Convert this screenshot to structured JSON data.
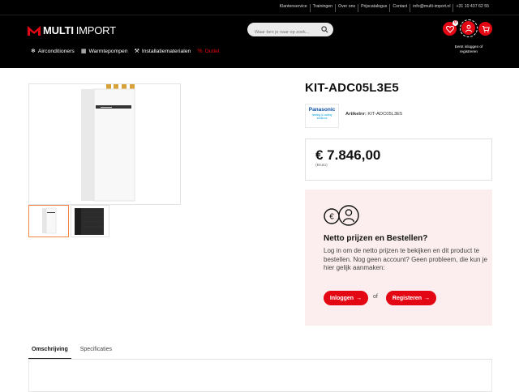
{
  "topbar": {
    "links": [
      "Klantenservice",
      "Trainingen",
      "Over ons",
      "Prijscatalogus",
      "Contact",
      "info@multi-import.nl",
      "+31 10 437 62 55"
    ]
  },
  "logo": {
    "multi": "MULTI",
    "import": "IMPORT",
    "brand_color": "#e30613"
  },
  "search": {
    "placeholder": "Waar ben je naar op zoek..."
  },
  "header_icons": {
    "wishlist_count": "0",
    "login_text": "Eerst inloggen of registreren"
  },
  "nav": {
    "items": [
      {
        "label": "Airconditioners",
        "icon": "snowflake-icon"
      },
      {
        "label": "Warmtepompen",
        "icon": "heatpump-icon"
      },
      {
        "label": "Installatiematerialen",
        "icon": "tools-icon"
      },
      {
        "label": "Outlet",
        "icon": "percent-icon"
      }
    ]
  },
  "product": {
    "title": "KIT-ADC05L3E5",
    "brand": "Panasonic",
    "brand_tagline": "heating & cooling solutions",
    "article_label": "Artikelnr:",
    "article_number": "KIT-ADC05L3E5",
    "price": "€ 7.846,00",
    "price_note": "(Bruto)"
  },
  "login_box": {
    "heading": "Netto prijzen en Bestellen?",
    "text": "Log in om de netto prijzen te bekijken en dit product te bestellen. Nog geen account? Geen probleem, die kun je hier gelijk aanmaken:",
    "login_label": "Inloggen",
    "or_label": "of",
    "register_label": "Registeren"
  },
  "tabs": [
    {
      "label": "Omschrijving",
      "active": true
    },
    {
      "label": "Specificaties",
      "active": false
    }
  ]
}
